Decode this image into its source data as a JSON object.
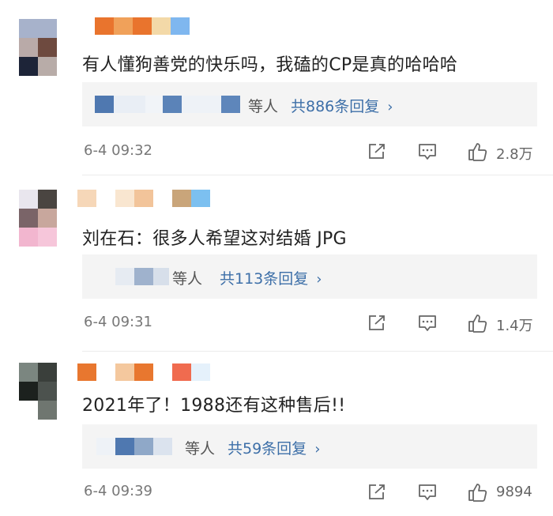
{
  "comments": [
    {
      "text": "有人懂狗善党的快乐吗，我磕的CP是真的哈哈哈",
      "reply_others": "等人",
      "reply_total": "共886条回复",
      "reply_chevron": "›",
      "time": "6-4 09:32",
      "likes": "2.8万"
    },
    {
      "text": "刘在石：很多人希望这对结婚  JPG",
      "reply_others": "等人",
      "reply_total": "共113条回复",
      "reply_chevron": "›",
      "time": "6-4 09:31",
      "likes": "1.4万"
    },
    {
      "text": "2021年了！1988还有这种售后!!",
      "reply_others": "等人",
      "reply_total": "共59条回复",
      "reply_chevron": "›",
      "time": "6-4 09:39",
      "likes": "9894"
    }
  ],
  "icons": {
    "share": "share-icon",
    "comment": "comment-icon",
    "like": "thumbs-up-icon"
  },
  "colors": {
    "link_blue": "#3d6fa8",
    "meta_gray": "#777777",
    "reply_bg": "#f4f4f4"
  }
}
